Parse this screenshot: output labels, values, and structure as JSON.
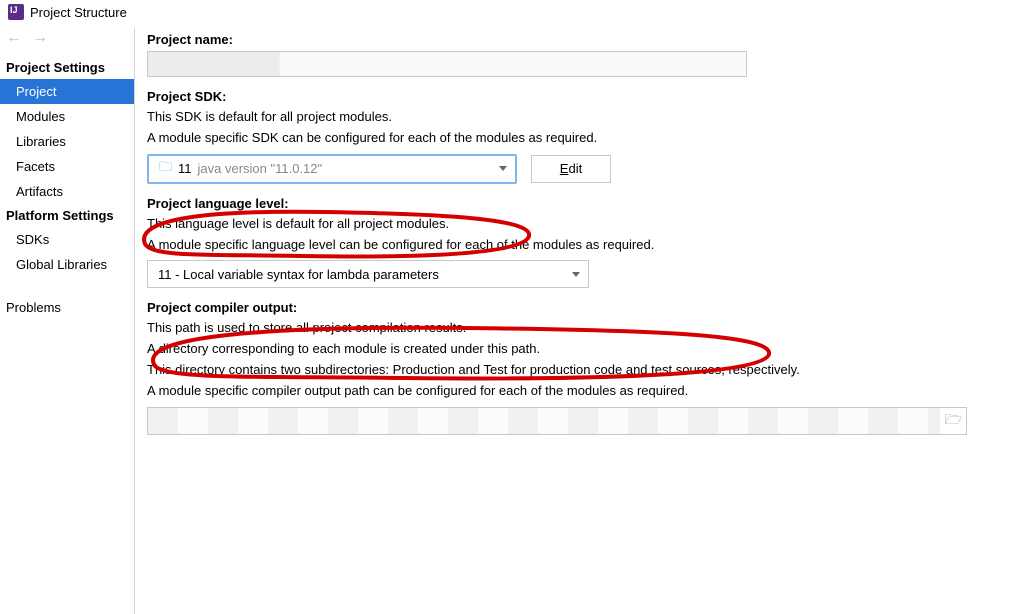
{
  "title": "Project Structure",
  "sidebar": {
    "heading_project_settings": "Project Settings",
    "heading_platform_settings": "Platform Settings",
    "items_project": {
      "project": "Project",
      "modules": "Modules",
      "libraries": "Libraries",
      "facets": "Facets",
      "artifacts": "Artifacts"
    },
    "items_platform": {
      "sdks": "SDKs",
      "global_libraries": "Global Libraries"
    },
    "problems": "Problems"
  },
  "labels": {
    "project_name": "Project name:",
    "project_sdk": "Project SDK:",
    "language_level": "Project language level:",
    "compiler_output": "Project compiler output:",
    "edit": "Edit"
  },
  "sdk": {
    "desc1": "This SDK is default for all project modules.",
    "desc2": "A module specific SDK can be configured for each of the modules as required.",
    "version_short": "11",
    "version_long": "java version \"11.0.12\""
  },
  "lang": {
    "desc1": "This language level is default for all project modules.",
    "desc2": "A module specific language level can be configured for each of the modules as required.",
    "value": "11 - Local variable syntax for lambda parameters"
  },
  "output": {
    "desc1": "This path is used to store all project compilation results.",
    "desc2": "A directory corresponding to each module is created under this path.",
    "desc3": "This directory contains two subdirectories: Production and Test for production code and test sources, respectively.",
    "desc4": "A module specific compiler output path can be configured for each of the modules as required."
  }
}
